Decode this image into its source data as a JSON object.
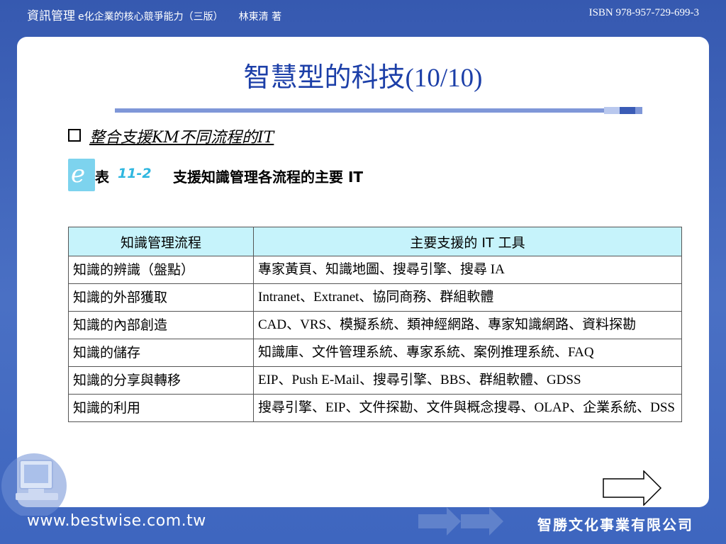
{
  "header": {
    "title": "資訊管理",
    "subtitle": "e化企業的核心競爭能力（三版）",
    "author": "林東清 著",
    "isbn": "ISBN 978-957-729-699-3"
  },
  "slide": {
    "title_text": "智慧型的科技",
    "title_num": "(10/10)",
    "bullet": "整合支援KM不同流程的IT",
    "caption_prefix": "表",
    "caption_number": "11-2",
    "caption_text": "支援知識管理各流程的主要 IT"
  },
  "table": {
    "headers": [
      "知識管理流程",
      "主要支援的 IT 工具"
    ],
    "rows": [
      [
        "知識的辨識（盤點）",
        "專家黃頁、知識地圖、搜尋引擎、搜尋 IA"
      ],
      [
        "知識的外部獲取",
        "Intranet、Extranet、協同商務、群組軟體"
      ],
      [
        "知識的內部創造",
        "CAD、VRS、模擬系統、類神經網路、專家知識網路、資料探勘"
      ],
      [
        "知識的儲存",
        "知識庫、文件管理系統、專家系統、案例推理系統、FAQ"
      ],
      [
        "知識的分享與轉移",
        "EIP、Push E-Mail、搜尋引擎、BBS、群組軟體、GDSS"
      ],
      [
        "知識的利用",
        "搜尋引擎、EIP、文件探勘、文件與概念搜尋、OLAP、企業系統、DSS"
      ]
    ]
  },
  "footer": {
    "url": "www.bestwise.com.tw",
    "publisher": "智勝文化事業有限公司"
  },
  "colors": {
    "background": "#3f63b8",
    "title": "#1c3fa8",
    "table_header": "#c6f3fb"
  }
}
